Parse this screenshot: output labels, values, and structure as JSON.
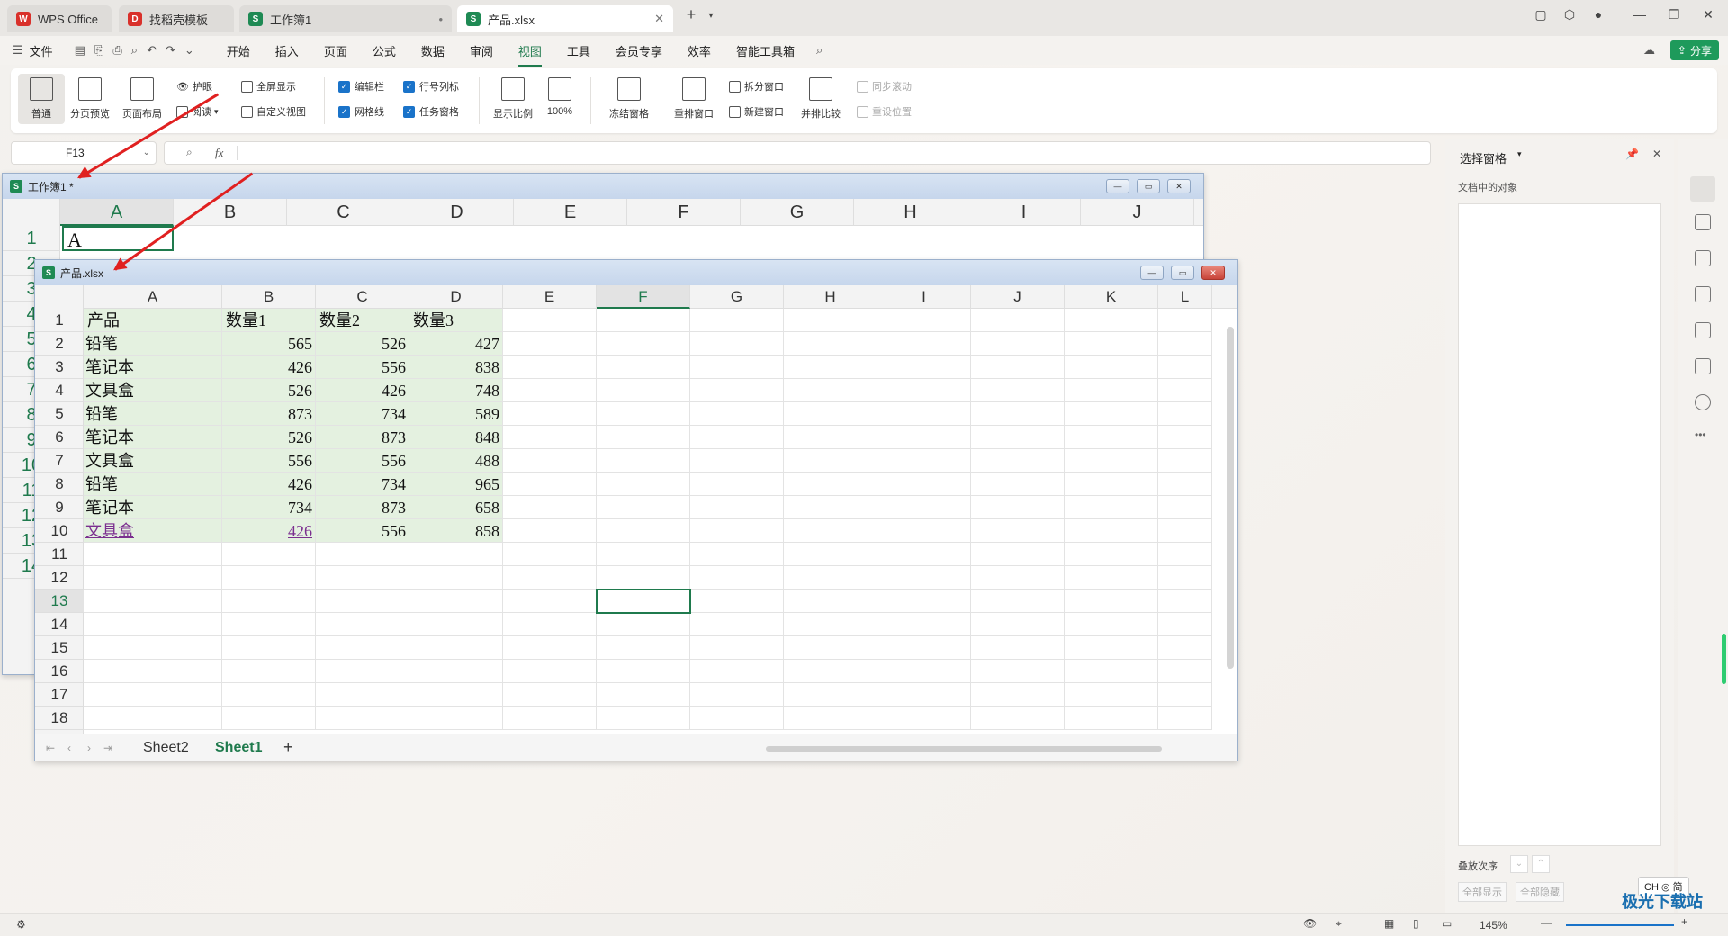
{
  "tabs": [
    {
      "label": "WPS Office",
      "icon": "W",
      "color": "#d9312b",
      "active": false
    },
    {
      "label": "找稻壳模板",
      "icon": "D",
      "color": "#d9312b",
      "active": false
    },
    {
      "label": "工作簿1",
      "icon": "S",
      "color": "#1f8a54",
      "active": false
    },
    {
      "label": "产品.xlsx",
      "icon": "S",
      "color": "#1f8a54",
      "active": true
    }
  ],
  "menu": {
    "file_label": "文件",
    "items": [
      "开始",
      "插入",
      "页面",
      "公式",
      "数据",
      "审阅",
      "视图",
      "工具",
      "会员专享",
      "效率",
      "智能工具箱"
    ],
    "active": "视图",
    "share_label": "分享"
  },
  "ribbon": {
    "normal": "普通",
    "page_break": "分页预览",
    "page_layout": "页面布局",
    "eye_protect": "护眼",
    "reading": "阅读",
    "fullscreen": "全屏显示",
    "custom_view": "自定义视图",
    "edit_bar": "编辑栏",
    "row_col_header": "行号列标",
    "gridlines": "网格线",
    "task_pane": "任务窗格",
    "zoom_ratio": "显示比例",
    "zoom_100": "100%",
    "freeze": "冻结窗格",
    "rearrange": "重排窗口",
    "split": "拆分窗口",
    "new_window": "新建窗口",
    "side_by_side": "并排比较",
    "sync_scroll": "同步滚动",
    "reset_position": "重设位置"
  },
  "formula_bar": {
    "cell_ref": "F13",
    "fx": "fx"
  },
  "window1": {
    "title": "工作簿1 *",
    "columns": [
      "A",
      "B",
      "C",
      "D",
      "E",
      "F",
      "G",
      "H",
      "I",
      "J"
    ],
    "rows": [
      "1",
      "2",
      "3",
      "4",
      "5",
      "6",
      "7",
      "8",
      "9",
      "10",
      "11",
      "12",
      "13",
      "14"
    ],
    "a1": "A"
  },
  "window2": {
    "title": "产品.xlsx",
    "columns": [
      "A",
      "B",
      "C",
      "D",
      "E",
      "F",
      "G",
      "H",
      "I",
      "J",
      "K",
      "L"
    ],
    "rows": [
      "1",
      "2",
      "3",
      "4",
      "5",
      "6",
      "7",
      "8",
      "9",
      "10",
      "11",
      "12",
      "13",
      "14",
      "15",
      "16",
      "17",
      "18"
    ],
    "header": [
      "产品",
      "数量1",
      "数量2",
      "数量3"
    ],
    "data": [
      [
        "铅笔",
        "565",
        "526",
        "427"
      ],
      [
        "笔记本",
        "426",
        "556",
        "838"
      ],
      [
        "文具盒",
        "526",
        "426",
        "748"
      ],
      [
        "铅笔",
        "873",
        "734",
        "589"
      ],
      [
        "笔记本",
        "526",
        "873",
        "848"
      ],
      [
        "文具盒",
        "556",
        "556",
        "488"
      ],
      [
        "铅笔",
        "426",
        "734",
        "965"
      ],
      [
        "笔记本",
        "734",
        "873",
        "658"
      ],
      [
        "文具盒",
        "426",
        "556",
        "858"
      ]
    ],
    "sheets": [
      "Sheet2",
      "Sheet1"
    ],
    "active_sheet": "Sheet1"
  },
  "side_pane": {
    "title": "选择窗格",
    "objects_label": "文档中的对象",
    "order_label": "叠放次序",
    "show_all": "全部显示",
    "hide_all": "全部隐藏"
  },
  "status": {
    "zoom": "145%",
    "ime": "CH ◎ 简"
  },
  "watermark": "极光下载站"
}
